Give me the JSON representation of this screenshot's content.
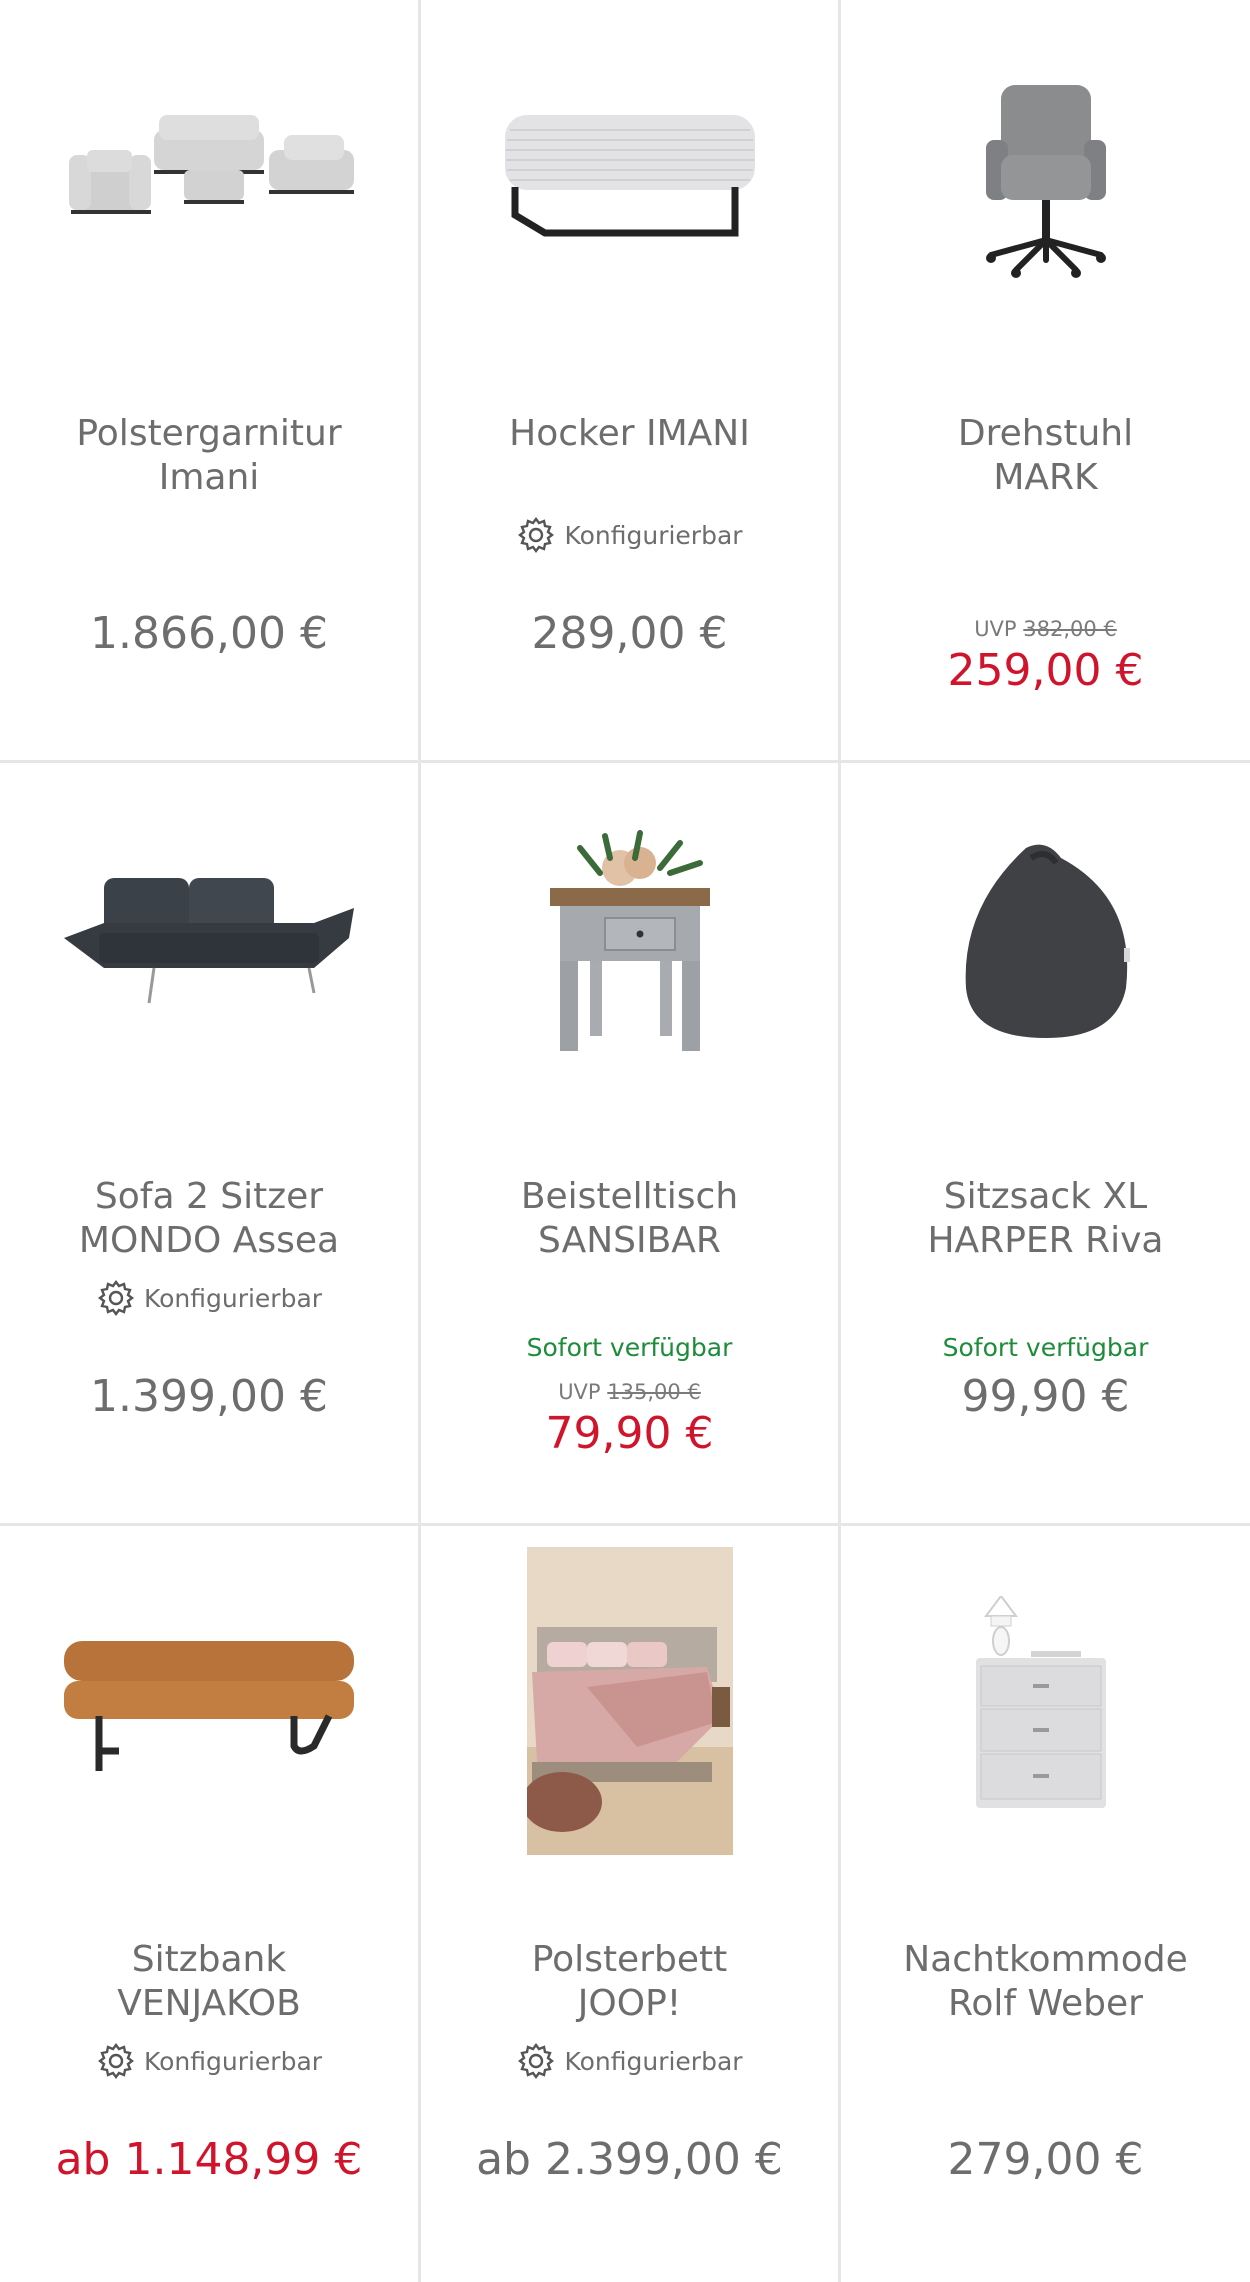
{
  "products": [
    {
      "title_line1": "Polstergarnitur",
      "title_line2": "Imani",
      "configurable": false,
      "price": "1.866,00 €",
      "sale": false
    },
    {
      "title_line1": "Hocker IMANI",
      "title_line2": "",
      "configurable": true,
      "config_label": "Konfigurierbar",
      "price": "289,00 €",
      "sale": false
    },
    {
      "title_line1": "Drehstuhl",
      "title_line2": "MARK",
      "configurable": false,
      "uvp_label": "UVP",
      "uvp_price": "382,00 €",
      "price": "259,00 €",
      "sale": true
    },
    {
      "title_line1": "Sofa 2 Sitzer",
      "title_line2": "MONDO Assea",
      "configurable": true,
      "config_label": "Konfigurierbar",
      "price": "1.399,00 €",
      "sale": false
    },
    {
      "title_line1": "Beistelltisch",
      "title_line2": "SANSIBAR",
      "configurable": false,
      "availability": "Sofort verfügbar",
      "uvp_label": "UVP",
      "uvp_price": "135,00 €",
      "price": "79,90 €",
      "sale": true
    },
    {
      "title_line1": "Sitzsack XL",
      "title_line2": "HARPER Riva",
      "configurable": false,
      "availability": "Sofort verfügbar",
      "price": "99,90 €",
      "sale": false
    },
    {
      "title_line1": "Sitzbank",
      "title_line2": "VENJAKOB",
      "configurable": true,
      "config_label": "Konfigurierbar",
      "price": "ab 1.148,99 €",
      "sale": true
    },
    {
      "title_line1": "Polsterbett",
      "title_line2": "JOOP!",
      "configurable": true,
      "config_label": "Konfigurierbar",
      "price": "ab 2.399,00 €",
      "sale": false
    },
    {
      "title_line1": "Nachtkommode",
      "title_line2": "Rolf Weber",
      "configurable": false,
      "price": "279,00 €",
      "sale": false
    }
  ],
  "colors": {
    "sale_price": "#d0142b",
    "availability": "#1e8c3a",
    "text": "#6d6d6d",
    "divider": "#e6e6e6"
  },
  "icons": {
    "configurable": "gear-icon"
  }
}
